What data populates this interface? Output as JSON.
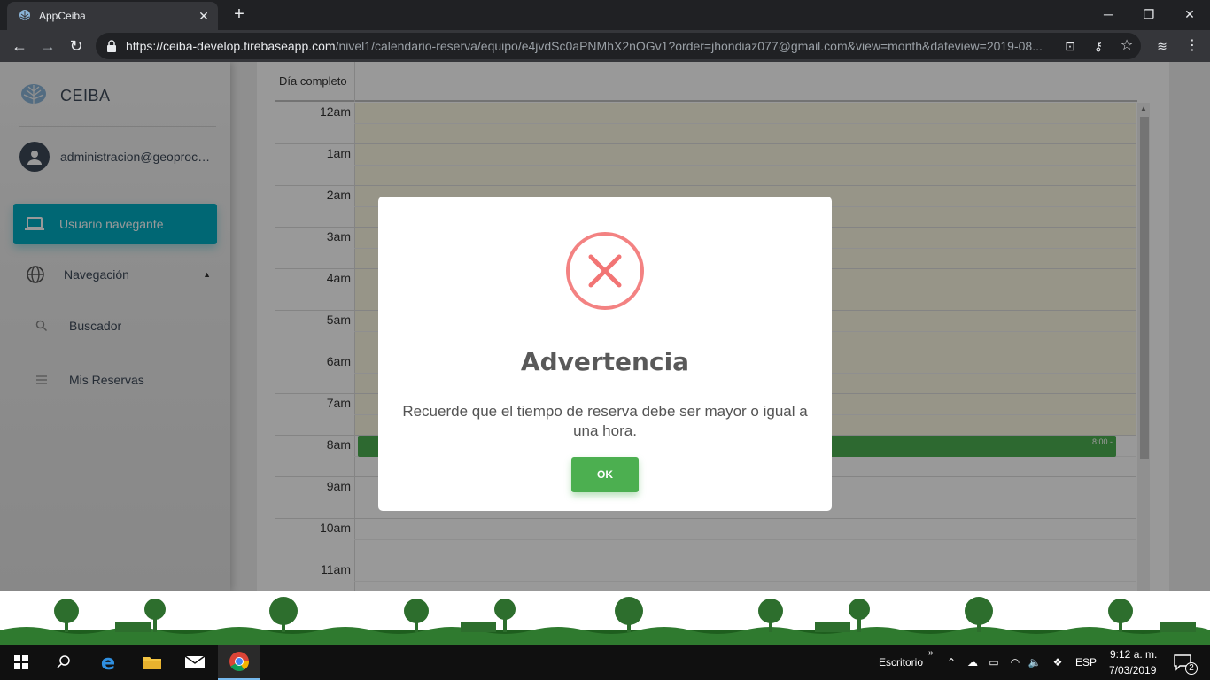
{
  "browser": {
    "tab_title": "AppCeiba",
    "url_host": "https://ceiba-develop.firebaseapp.com",
    "url_path": "/nivel1/calendario-reserva/equipo/e4jvdSc0aPNMhX2nOGv1?order=jhondiaz077@gmail.com&view=month&dateview=2019-08..."
  },
  "sidebar": {
    "brand": "CEIBA",
    "user": "administracion@geoprocesamiento...",
    "items": [
      {
        "label": "Usuario navegante",
        "icon": "laptop-icon"
      },
      {
        "label": "Navegación",
        "icon": "globe-icon"
      },
      {
        "label": "Buscador",
        "icon": "search-icon"
      },
      {
        "label": "Mis Reservas",
        "icon": "list-icon"
      }
    ]
  },
  "calendar": {
    "allday_label": "Día completo",
    "hours": [
      "12am",
      "1am",
      "2am",
      "3am",
      "4am",
      "5am",
      "6am",
      "7am",
      "8am",
      "9am",
      "10am",
      "11am"
    ],
    "event_time": "8:00 -"
  },
  "modal": {
    "title": "Advertencia",
    "message": "Recuerde que el tiempo de reserva debe ser mayor o igual a una hora.",
    "ok_label": "OK"
  },
  "taskbar": {
    "desktop_label": "Escritorio",
    "language": "ESP",
    "time": "9:12 a. m.",
    "date": "7/03/2019",
    "notification_count": "2"
  },
  "colors": {
    "active_nav": "#00acc1",
    "event": "#4caf50",
    "error_icon": "#f27474",
    "ok_button": "#4caf50"
  }
}
